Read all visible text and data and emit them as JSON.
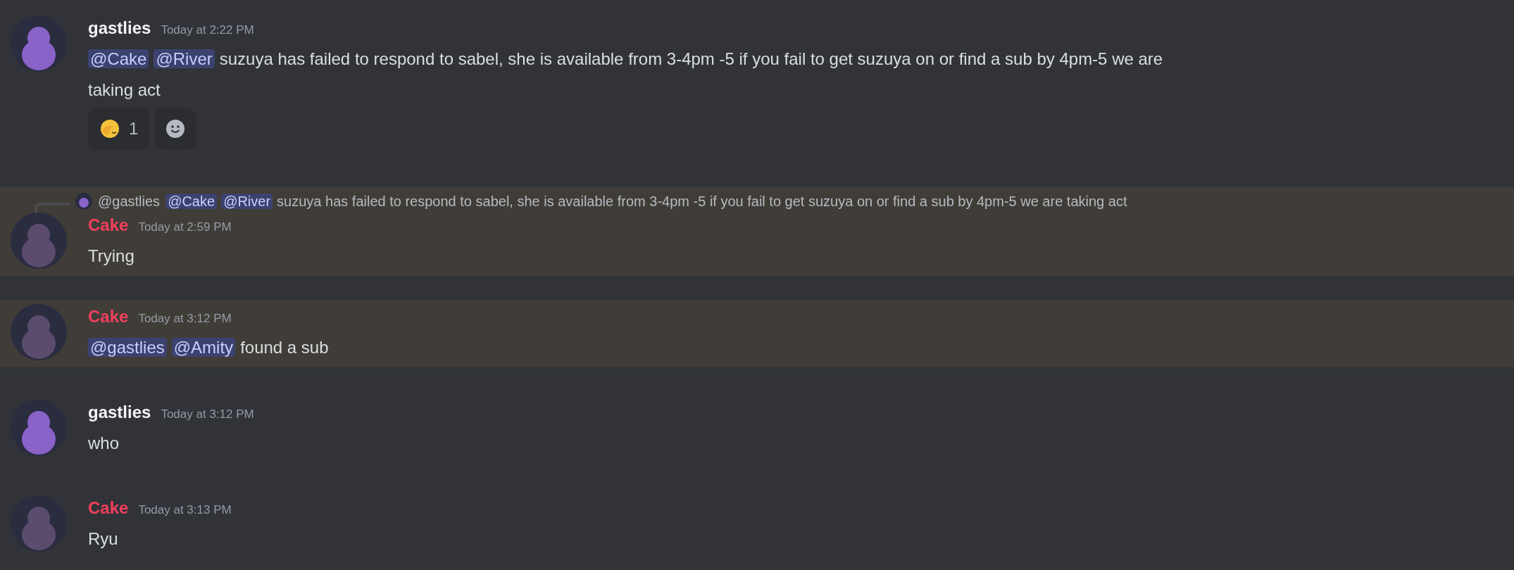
{
  "messages": [
    {
      "author": {
        "name": "gastlies",
        "color": "#f2f3f5"
      },
      "avatar": {
        "color": "#8a63c9"
      },
      "timestamp": "Today at 2:22 PM",
      "content": [
        {
          "kind": "mention",
          "text": "@Cake"
        },
        {
          "kind": "mention",
          "text": "@River"
        },
        {
          "kind": "text",
          "text": "suzuya has failed to respond to sabel, she is available from 3-4pm -5 if you fail to get suzuya on or find a sub by 4pm-5 we are taking act"
        }
      ],
      "reactions": [
        {
          "count": "1"
        }
      ]
    },
    {
      "author": {
        "name": "Cake",
        "color": "#f23f5d"
      },
      "avatar": {
        "color": "#5b4c6e"
      },
      "timestamp": "Today at 2:59 PM",
      "highlighted": true,
      "reply": {
        "author": "@gastlies",
        "content": [
          {
            "kind": "mention",
            "text": "@Cake"
          },
          {
            "kind": "mention",
            "text": "@River"
          },
          {
            "kind": "text",
            "text": "suzuya has failed to respond to sabel, she is available from 3-4pm -5 if you fail to get suzuya on or find a sub by 4pm-5 we are taking act"
          }
        ]
      },
      "content": [
        {
          "kind": "text",
          "text": "Trying"
        }
      ]
    },
    {
      "author": {
        "name": "Cake",
        "color": "#f23f5d"
      },
      "avatar": {
        "color": "#5b4c6e"
      },
      "timestamp": "Today at 3:12 PM",
      "highlighted": true,
      "content": [
        {
          "kind": "mention",
          "text": "@gastlies"
        },
        {
          "kind": "mention",
          "text": "@Amity"
        },
        {
          "kind": "text",
          "text": "found a sub"
        }
      ]
    },
    {
      "author": {
        "name": "gastlies",
        "color": "#f2f3f5"
      },
      "avatar": {
        "color": "#8a63c9"
      },
      "timestamp": "Today at 3:12 PM",
      "content": [
        {
          "kind": "text",
          "text": "who"
        }
      ]
    },
    {
      "author": {
        "name": "Cake",
        "color": "#f23f5d"
      },
      "avatar": {
        "color": "#5b4c6e"
      },
      "timestamp": "Today at 3:13 PM",
      "content": [
        {
          "kind": "text",
          "text": "Ryu"
        }
      ]
    }
  ]
}
